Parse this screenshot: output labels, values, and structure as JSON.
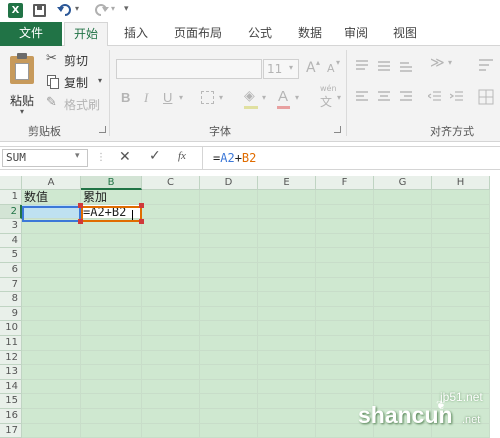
{
  "qat": {
    "app_icon": "excel-icon",
    "save_icon": "save-icon",
    "undo_icon": "undo-icon",
    "redo_icon": "redo-icon",
    "customize": "▾"
  },
  "tabs": [
    "文件",
    "开始",
    "插入",
    "页面布局",
    "公式",
    "数据",
    "审阅",
    "视图"
  ],
  "clipboard": {
    "paste": "粘贴",
    "cut": "剪切",
    "copy": "复制",
    "format_painter": "格式刷",
    "group": "剪贴板"
  },
  "font": {
    "size": "11",
    "grow": "A",
    "shrink": "A",
    "bold": "B",
    "italic": "I",
    "underline": "U",
    "wen": "文",
    "group": "字体"
  },
  "alignment": {
    "group": "对齐方式"
  },
  "formula_bar": {
    "name_box": "SUM",
    "fx": "fx",
    "formula_eq": "=",
    "ref1": "A2",
    "plus": "+",
    "ref2": "B2"
  },
  "columns": [
    "A",
    "B",
    "C",
    "D",
    "E",
    "F",
    "G",
    "H"
  ],
  "rows": [
    "1",
    "2",
    "3",
    "4",
    "5",
    "6",
    "7",
    "8",
    "9",
    "10",
    "11",
    "12",
    "13",
    "14",
    "15",
    "16",
    "17"
  ],
  "cells": {
    "A1": "数值",
    "B1": "累加",
    "B2": "=A2+B2"
  },
  "watermark": {
    "domain": "jb51.net",
    "brand": "shancun",
    "net": ".net"
  },
  "colors": {
    "excel_green": "#217346",
    "grid_fill": "#cfe8d0",
    "ref_blue": "#3c78d8",
    "ref_orange": "#e06c00",
    "ref_red": "#d0393a"
  }
}
